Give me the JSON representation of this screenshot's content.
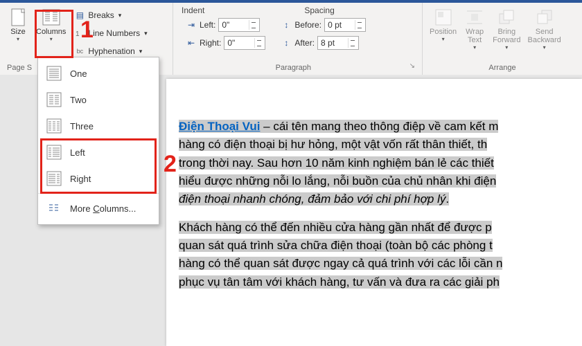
{
  "ribbon": {
    "pageSetup": {
      "label": "Page S",
      "size": "Size",
      "columns": "Columns",
      "breaks": "Breaks",
      "lineNumbers": "Line Numbers",
      "hyphenation": "Hyphenation"
    },
    "paragraph": {
      "label": "Paragraph",
      "indentHeader": "Indent",
      "spacingHeader": "Spacing",
      "left": "Left:",
      "right": "Right:",
      "before": "Before:",
      "after": "After:",
      "leftVal": "0\"",
      "rightVal": "0\"",
      "beforeVal": "0 pt",
      "afterVal": "8 pt"
    },
    "arrange": {
      "label": "Arrange",
      "position": "Position",
      "wrap": "Wrap\nText",
      "bring": "Bring\nForward",
      "send": "Send\nBackward"
    }
  },
  "columnsMenu": {
    "one": "One",
    "two": "Two",
    "three": "Three",
    "left": "Left",
    "right": "Right",
    "more": "More Columns..."
  },
  "doc": {
    "linkText": "Điện Thoại Vui",
    "p1a": " – cái tên mang theo thông điệp về cam kết m",
    "p1b": "hàng có điện thoại bị hư hỏng, một vật vốn rất thân thiết, th",
    "p1c": "trong thời nay. Sau hơn 10 năm kinh nghiệm bán lẻ các thiết",
    "p1d": "hiểu được những nỗi lo lắng, nỗi buồn của chủ nhân khi điện",
    "p1e": "điện thoại nhanh chóng, đảm bảo với chi phí hợp lý",
    "p1f": ".",
    "p2a": "Khách hàng có thể đến nhiều cửa hàng gần nhất để được p",
    "p2b": "quan sát quá trình sửa chữa điện thoại (toàn bộ các phòng t",
    "p2c": "hàng có thể quan sát được ngay cả quá trình với các lỗi cần n",
    "p2d": "phục vụ tân tâm với khách hàng, tư vấn và đưa ra các giải ph"
  },
  "annotations": {
    "n1": "1",
    "n2": "2"
  }
}
